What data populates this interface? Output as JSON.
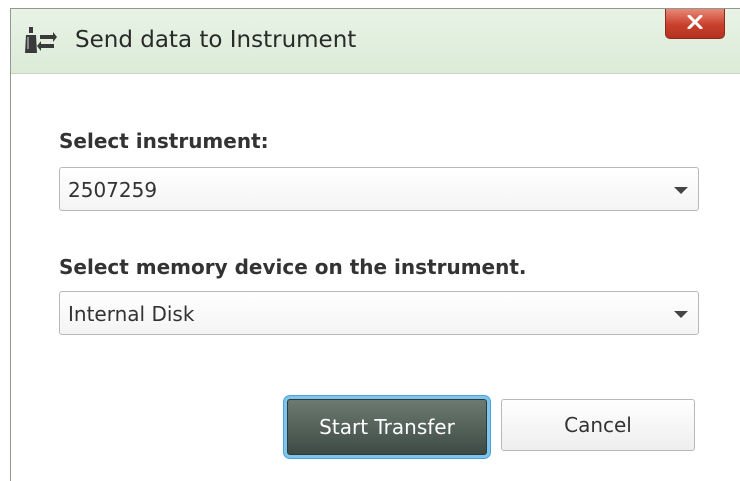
{
  "dialog": {
    "title": "Send data to Instrument",
    "close_label": "X"
  },
  "instrument": {
    "label": "Select instrument:",
    "selected": "2507259"
  },
  "memory": {
    "label": "Select memory device on the instrument.",
    "selected": "Internal Disk"
  },
  "buttons": {
    "start_transfer": "Start Transfer",
    "cancel": "Cancel"
  },
  "colors": {
    "titlebar": "#dcebd8",
    "close_button": "#c9402d",
    "primary_button": "#4a5750",
    "focus_ring": "#7ec4f0"
  }
}
